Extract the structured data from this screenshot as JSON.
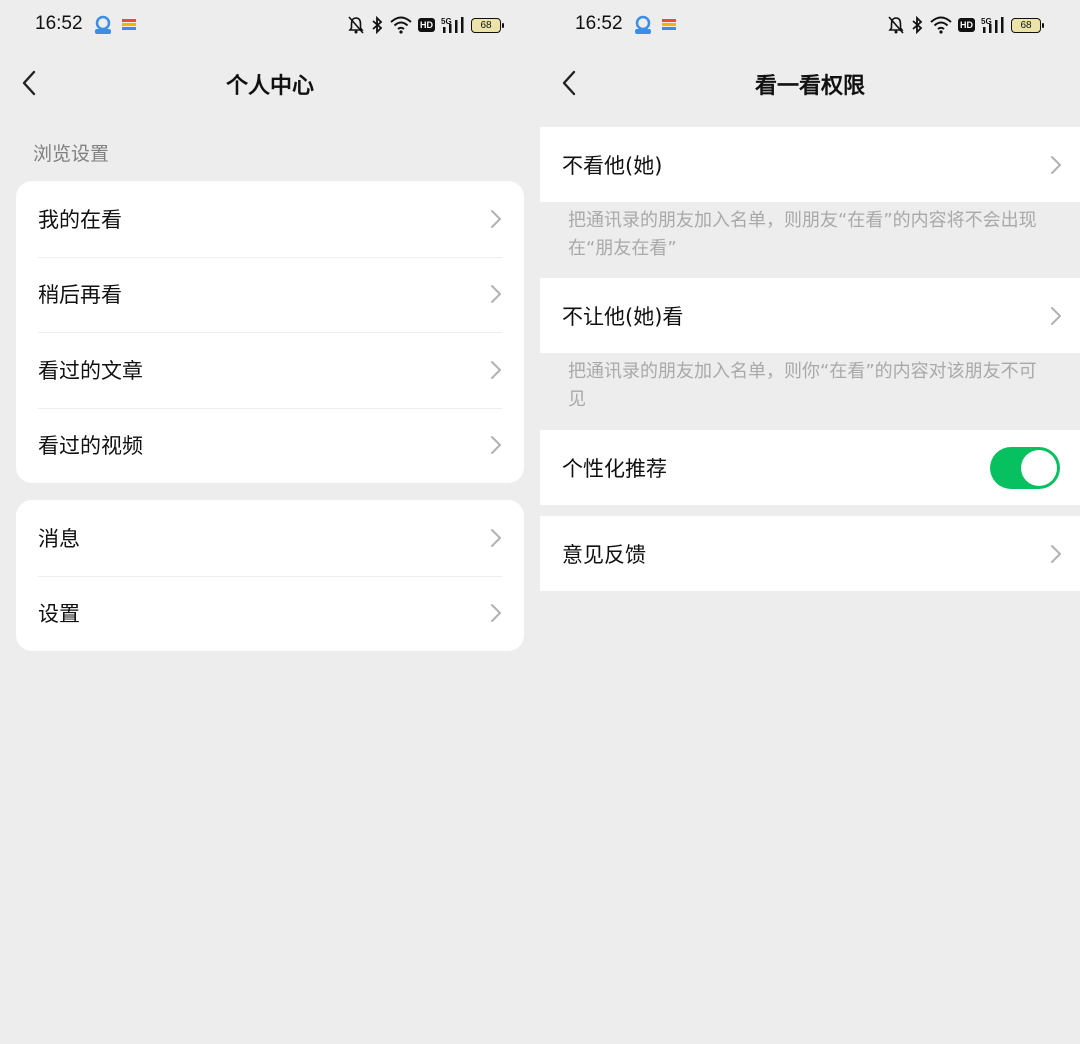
{
  "left": {
    "status": {
      "time": "16:52",
      "battery": "68",
      "hd": "HD",
      "net": "5G"
    },
    "nav": {
      "title": "个人中心"
    },
    "section_label": "浏览设置",
    "group1": [
      {
        "label": "我的在看"
      },
      {
        "label": "稍后再看"
      },
      {
        "label": "看过的文章"
      },
      {
        "label": "看过的视频"
      }
    ],
    "group2": [
      {
        "label": "消息"
      },
      {
        "label": "设置"
      }
    ]
  },
  "right": {
    "status": {
      "time": "16:52",
      "battery": "68",
      "hd": "HD",
      "net": "5G"
    },
    "nav": {
      "title": "看一看权限"
    },
    "items": [
      {
        "label": "不看他(她)",
        "desc": "把通讯录的朋友加入名单，则朋友“在看”的内容将不会出现在“朋友在看”"
      },
      {
        "label": "不让他(她)看",
        "desc": "把通讯录的朋友加入名单，则你“在看”的内容对该朋友不可见"
      },
      {
        "label": "个性化推荐",
        "toggle_on": true
      },
      {
        "label": "意见反馈"
      }
    ]
  },
  "colors": {
    "accent": "#07c160",
    "background": "#ededed",
    "card": "#ffffff"
  },
  "icons": [
    "back-arrow-icon",
    "chevron-right-icon",
    "mute-bell-icon",
    "bluetooth-icon",
    "wifi-icon",
    "signal-icon",
    "battery-icon",
    "notification-app-icon"
  ]
}
